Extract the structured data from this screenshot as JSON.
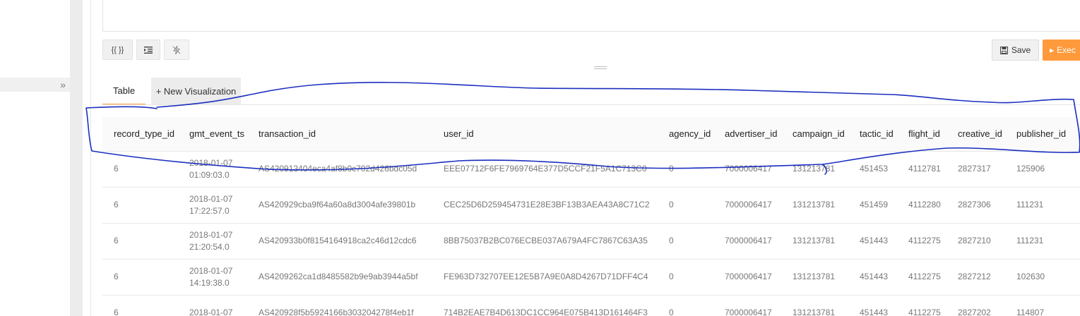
{
  "toolbar": {
    "format_label": "{{ }}",
    "save_label": "Save",
    "execute_label": "Exec"
  },
  "tabs": [
    {
      "label": "Table"
    },
    {
      "label": "+ New Visualization"
    }
  ],
  "table": {
    "columns": [
      "record_type_id",
      "gmt_event_ts",
      "transaction_id",
      "user_id",
      "agency_id",
      "advertiser_id",
      "campaign_id",
      "tactic_id",
      "flight_id",
      "creative_id",
      "publisher_id"
    ],
    "rows": [
      [
        "6",
        "2018-01-07 01:09:03.0",
        "AS420913404eca4af8b0c702d426bdc05d",
        "EEE07712F6FE7969764E377D5CCF21F5A1C713C0",
        "0",
        "7000006417",
        "131213781",
        "451453",
        "4112781",
        "2827317",
        "125906"
      ],
      [
        "6",
        "2018-01-07 17:22:57.0",
        "AS420929cba9f64a60a8d3004afe39801b",
        "CEC25D6D259454731E28E3BF13B3AEA43A8C71C2",
        "0",
        "7000006417",
        "131213781",
        "451459",
        "4112280",
        "2827306",
        "111231"
      ],
      [
        "6",
        "2018-01-07 21:20:54.0",
        "AS420933b0f8154164918ca2c46d12cdc6",
        "8BB75037B2BC076ECBE037A679A4FC7867C63A35",
        "0",
        "7000006417",
        "131213781",
        "451443",
        "4112275",
        "2827210",
        "111231"
      ],
      [
        "6",
        "2018-01-07 14:19:38.0",
        "AS4209262ca1d8485582b9e9ab3944a5bf",
        "FE963D732707EE12E5B7A9E0A8D4267D71DFF4C4",
        "0",
        "7000006417",
        "131213781",
        "451443",
        "4112275",
        "2827212",
        "102630"
      ],
      [
        "6",
        "2018-01-07",
        "AS420928f5b5924166b303204278f4eb1f",
        "714B2EAE7B4D613DC1CC964E075B413D161464F3",
        "0",
        "7000006417",
        "131213781",
        "451443",
        "4112275",
        "2827202",
        "114807"
      ]
    ]
  },
  "colors": {
    "accent": "#ff9a3c",
    "annotation": "#1a2fbf"
  }
}
